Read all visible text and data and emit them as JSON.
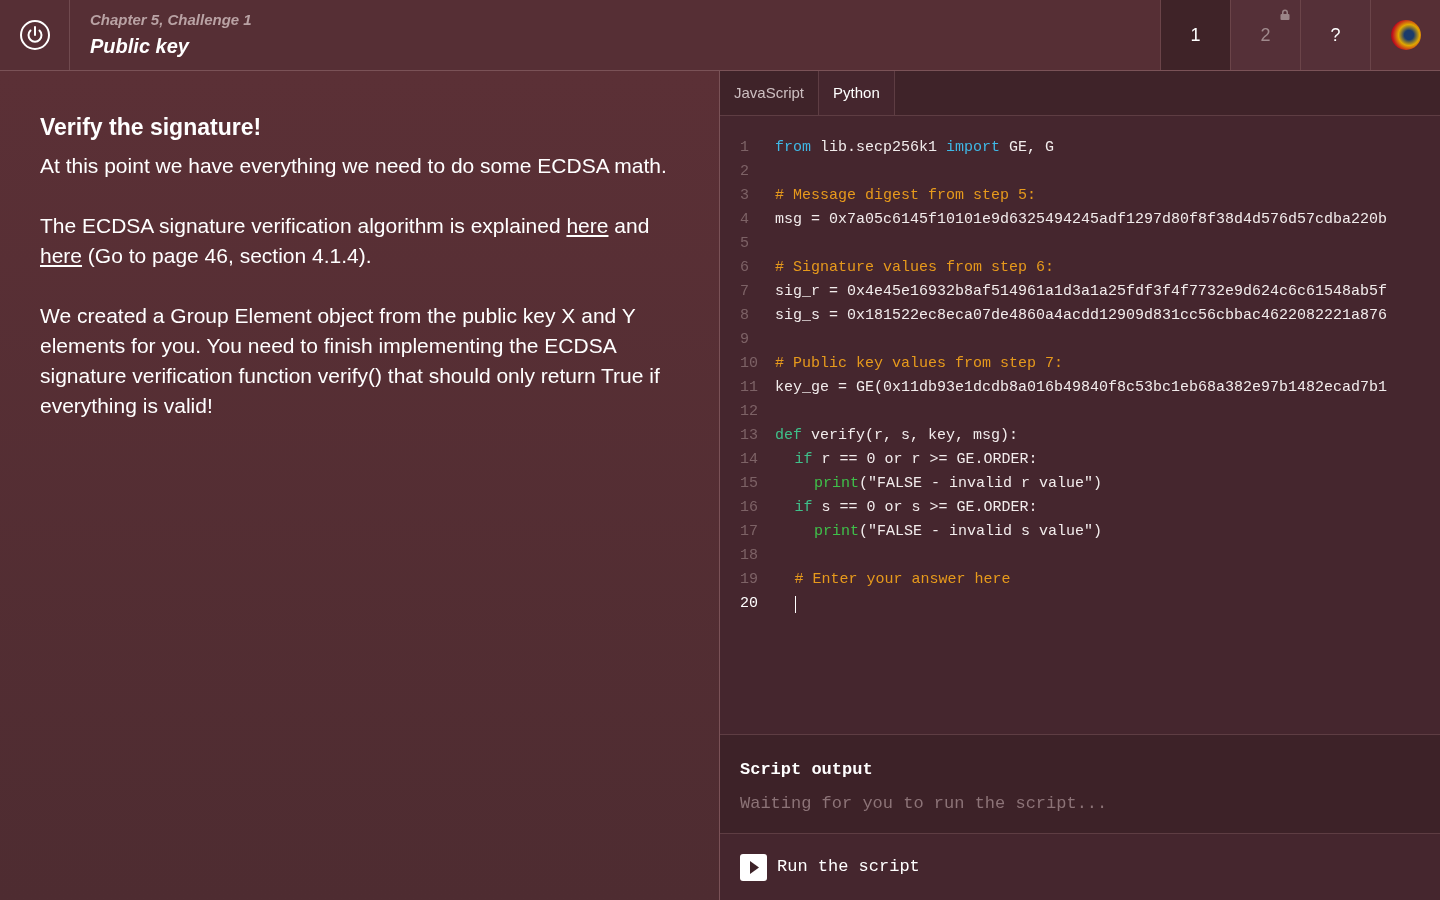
{
  "header": {
    "chapter": "Chapter 5, Challenge 1",
    "title": "Public key"
  },
  "nav": [
    {
      "label": "1",
      "selected": true,
      "locked": false
    },
    {
      "label": "2",
      "selected": false,
      "locked": true
    },
    {
      "label": "?",
      "selected": false,
      "locked": false
    }
  ],
  "lesson": {
    "heading": "Verify the signature!",
    "paragraphs": [
      [
        {
          "kind": "text",
          "text": "At this point we have everything we need to do some ECDSA math."
        }
      ],
      [
        {
          "kind": "text",
          "text": "The ECDSA signature verification algorithm is explained "
        },
        {
          "kind": "link",
          "text": "here"
        },
        {
          "kind": "text",
          "text": " and "
        },
        {
          "kind": "link",
          "text": "here"
        },
        {
          "kind": "text",
          "text": " (Go to page 46, section 4.1.4)."
        }
      ],
      [
        {
          "kind": "text",
          "text": "We created a Group Element object from the public key X and Y elements for you. You need to finish implementing the ECDSA signature verification function verify() that should only return True if everything is valid!"
        }
      ]
    ]
  },
  "editor": {
    "tabs": [
      {
        "label": "JavaScript",
        "selected": false
      },
      {
        "label": "Python",
        "selected": true
      }
    ],
    "lines": [
      {
        "number": "1",
        "active": false,
        "tokens": [
          {
            "kind": "keyword",
            "text": "from"
          },
          {
            "kind": "plain",
            "text": " lib.secp256k1 "
          },
          {
            "kind": "keyword",
            "text": "import"
          },
          {
            "kind": "plain",
            "text": " GE, G"
          }
        ]
      },
      {
        "number": "2",
        "active": false
      },
      {
        "number": "3",
        "active": false,
        "tokens": [
          {
            "kind": "comment",
            "text": "# Message digest from step 5:"
          }
        ]
      },
      {
        "number": "4",
        "active": false,
        "tokens": [
          {
            "kind": "plain",
            "text": "msg = 0x7a05c6145f10101e9d6325494245adf1297d80f8f38d4d576d57cdba220b"
          }
        ]
      },
      {
        "number": "5",
        "active": false
      },
      {
        "number": "6",
        "active": false,
        "tokens": [
          {
            "kind": "comment",
            "text": "# Signature values from step 6:"
          }
        ]
      },
      {
        "number": "7",
        "active": false,
        "tokens": [
          {
            "kind": "plain",
            "text": "sig_r = 0x4e45e16932b8af514961a1d3a1a25fdf3f4f7732e9d624c6c61548ab5f"
          }
        ]
      },
      {
        "number": "8",
        "active": false,
        "tokens": [
          {
            "kind": "plain",
            "text": "sig_s = 0x181522ec8eca07de4860a4acdd12909d831cc56cbbac4622082221a876"
          }
        ]
      },
      {
        "number": "9",
        "active": false
      },
      {
        "number": "10",
        "active": false,
        "tokens": [
          {
            "kind": "comment",
            "text": "# Public key values from step 7:"
          }
        ]
      },
      {
        "number": "11",
        "active": false,
        "tokens": [
          {
            "kind": "plain",
            "text": "key_ge = GE(0x11db93e1dcdb8a016b49840f8c53bc1eb68a382e97b1482ecad7b1"
          }
        ]
      },
      {
        "number": "12",
        "active": false
      },
      {
        "number": "13",
        "active": false,
        "tokens": [
          {
            "kind": "def",
            "text": "def"
          },
          {
            "kind": "plain",
            "text": " verify(r, s, key, msg):"
          }
        ],
        "children": [
          {
            "number": "14",
            "active": false,
            "tokens": [
              {
                "kind": "def",
                "text": "if"
              },
              {
                "kind": "plain",
                "text": " r == 0 or r >= GE.ORDER:"
              }
            ],
            "children": [
              {
                "number": "15",
                "active": false,
                "tokens": [
                  {
                    "kind": "builtin",
                    "text": "print"
                  },
                  {
                    "kind": "plain",
                    "text": "(\"FALSE - invalid r value\")"
                  }
                ]
              }
            ]
          },
          {
            "number": "16",
            "active": false,
            "tokens": [
              {
                "kind": "def",
                "text": "if"
              },
              {
                "kind": "plain",
                "text": " s == 0 or s >= GE.ORDER:"
              }
            ],
            "children": [
              {
                "number": "17",
                "active": false,
                "tokens": [
                  {
                    "kind": "builtin",
                    "text": "print"
                  },
                  {
                    "kind": "plain",
                    "text": "(\"FALSE - invalid s value\")"
                  }
                ]
              }
            ]
          },
          {
            "number": "18",
            "active": false
          },
          {
            "number": "19",
            "active": false,
            "tokens": [
              {
                "kind": "comment",
                "text": "# Enter your answer here"
              }
            ]
          },
          {
            "number": "20",
            "active": true
          }
        ]
      }
    ]
  },
  "output": {
    "title": "Script output",
    "message": "Waiting for you to run the script..."
  },
  "run_button": {
    "label": "Run the script"
  }
}
